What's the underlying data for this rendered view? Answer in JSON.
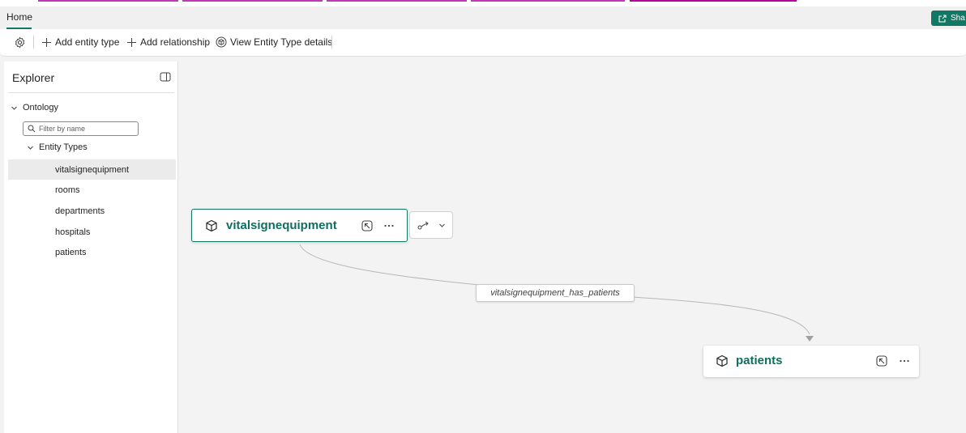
{
  "ribbon": {
    "tab_home": "Home",
    "share_label": "Sha"
  },
  "toolbar": {
    "add_entity_type": "Add entity type",
    "add_relationship": "Add relationship",
    "view_entity_type_details": "View Entity Type details"
  },
  "explorer": {
    "title": "Explorer",
    "root": "Ontology",
    "filter_placeholder": "Filter by name",
    "group": "Entity Types",
    "items": [
      {
        "label": "vitalsignequipment",
        "selected": true
      },
      {
        "label": "rooms",
        "selected": false
      },
      {
        "label": "departments",
        "selected": false
      },
      {
        "label": "hospitals",
        "selected": false
      },
      {
        "label": "patients",
        "selected": false
      }
    ]
  },
  "canvas": {
    "nodes": {
      "source": "vitalsignequipment",
      "target": "patients"
    },
    "edge_label": "vitalsignequipment_has_patients"
  },
  "colors": {
    "accent": "#117865",
    "node_title": "#0f6e5f",
    "canvas_bg": "#f3f3f3",
    "tab_highlight": "#c239b3"
  }
}
